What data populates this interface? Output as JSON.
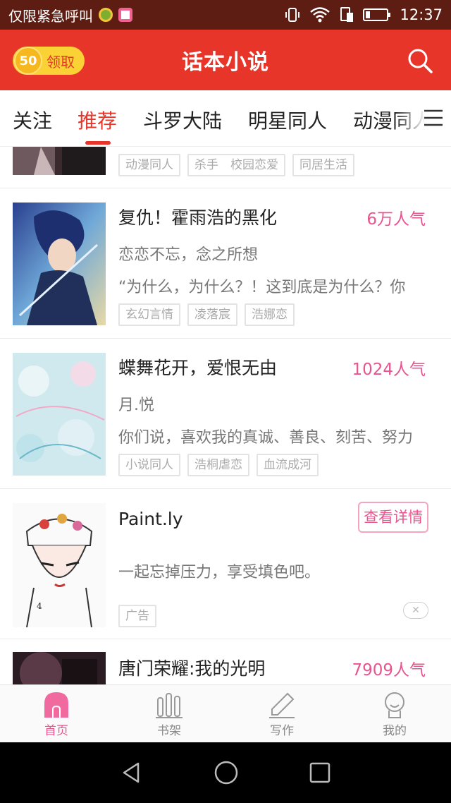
{
  "status_bar": {
    "carrier": "仅限紧急呼叫",
    "time": "12:37"
  },
  "header": {
    "coin_value": "50",
    "coin_label": "领取",
    "title": "话本小说"
  },
  "tabs": [
    {
      "label": "关注"
    },
    {
      "label": "推荐"
    },
    {
      "label": "斗罗大陆"
    },
    {
      "label": "明星同人"
    },
    {
      "label": "动漫同人"
    }
  ],
  "feed": {
    "partial_top": {
      "tags": [
        "动漫同人",
        "杀手　校园恋爱",
        "同居生活"
      ]
    },
    "items": [
      {
        "title": "复仇！霍雨浩的黑化",
        "popularity": "6万人气",
        "author": "恋恋不忘，念之所想",
        "description": "“为什么，为什么？！这到底是为什么？你",
        "tags": [
          "玄幻言情",
          "凌落宸",
          "浩娜恋"
        ]
      },
      {
        "title": "蝶舞花开，爱恨无由",
        "popularity": "1024人气",
        "author": "月.悦",
        "description": "你们说，喜欢我的真诚、善良、刻苦、努力",
        "tags": [
          "小说同人",
          "浩桐虐恋",
          "血流成河"
        ]
      }
    ],
    "ad": {
      "title": "Paint.ly",
      "button": "查看详情",
      "description": "一起忘掉压力，享受填色吧。",
      "tag": "广告",
      "close": "✕"
    },
    "partial_bottom": {
      "title": "唐门荣耀:我的光明",
      "popularity": "7909人气"
    }
  },
  "bottom_nav": [
    {
      "label": "首页",
      "icon": "home-icon"
    },
    {
      "label": "书架",
      "icon": "bookshelf-icon"
    },
    {
      "label": "写作",
      "icon": "pen-icon"
    },
    {
      "label": "我的",
      "icon": "profile-icon"
    }
  ],
  "colors": {
    "accent": "#e8352a",
    "pink": "#e9548e",
    "status_bar": "#5d1d12"
  }
}
